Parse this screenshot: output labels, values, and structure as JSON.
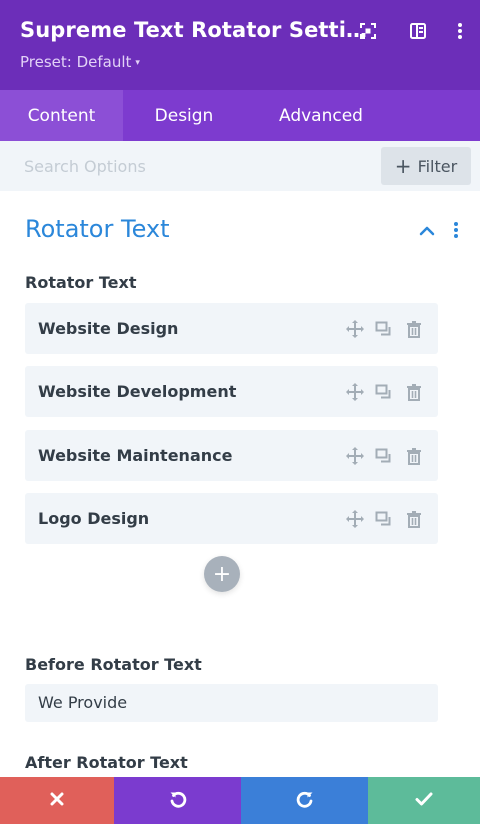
{
  "header": {
    "title": "Supreme Text Rotator Setti…",
    "preset_label": "Preset: Default",
    "preset_caret": "▾"
  },
  "tabs": [
    {
      "label": "Content",
      "active": true
    },
    {
      "label": "Design",
      "active": false
    },
    {
      "label": "Advanced",
      "active": false
    }
  ],
  "search": {
    "placeholder": "Search Options"
  },
  "filter": {
    "plus": "+",
    "label": "Filter"
  },
  "section": {
    "title": "Rotator Text"
  },
  "rotator": {
    "label": "Rotator Text",
    "items": [
      {
        "label": "Website Design"
      },
      {
        "label": "Website Development"
      },
      {
        "label": "Website Maintenance"
      },
      {
        "label": "Logo Design"
      }
    ],
    "add_symbol": "+"
  },
  "before": {
    "label": "Before Rotator Text",
    "value": "We Provide"
  },
  "after": {
    "label": "After Rotator Text"
  },
  "colors": {
    "header_bg": "#6c2eb9",
    "tabs_bg": "#7d3bcf",
    "tab_active_bg": "#8c4fd6",
    "accent_blue": "#2b87da",
    "cancel": "#e0605a",
    "undo": "#7b3bcf",
    "redo": "#3b7fd8",
    "save": "#5dbb9a"
  }
}
